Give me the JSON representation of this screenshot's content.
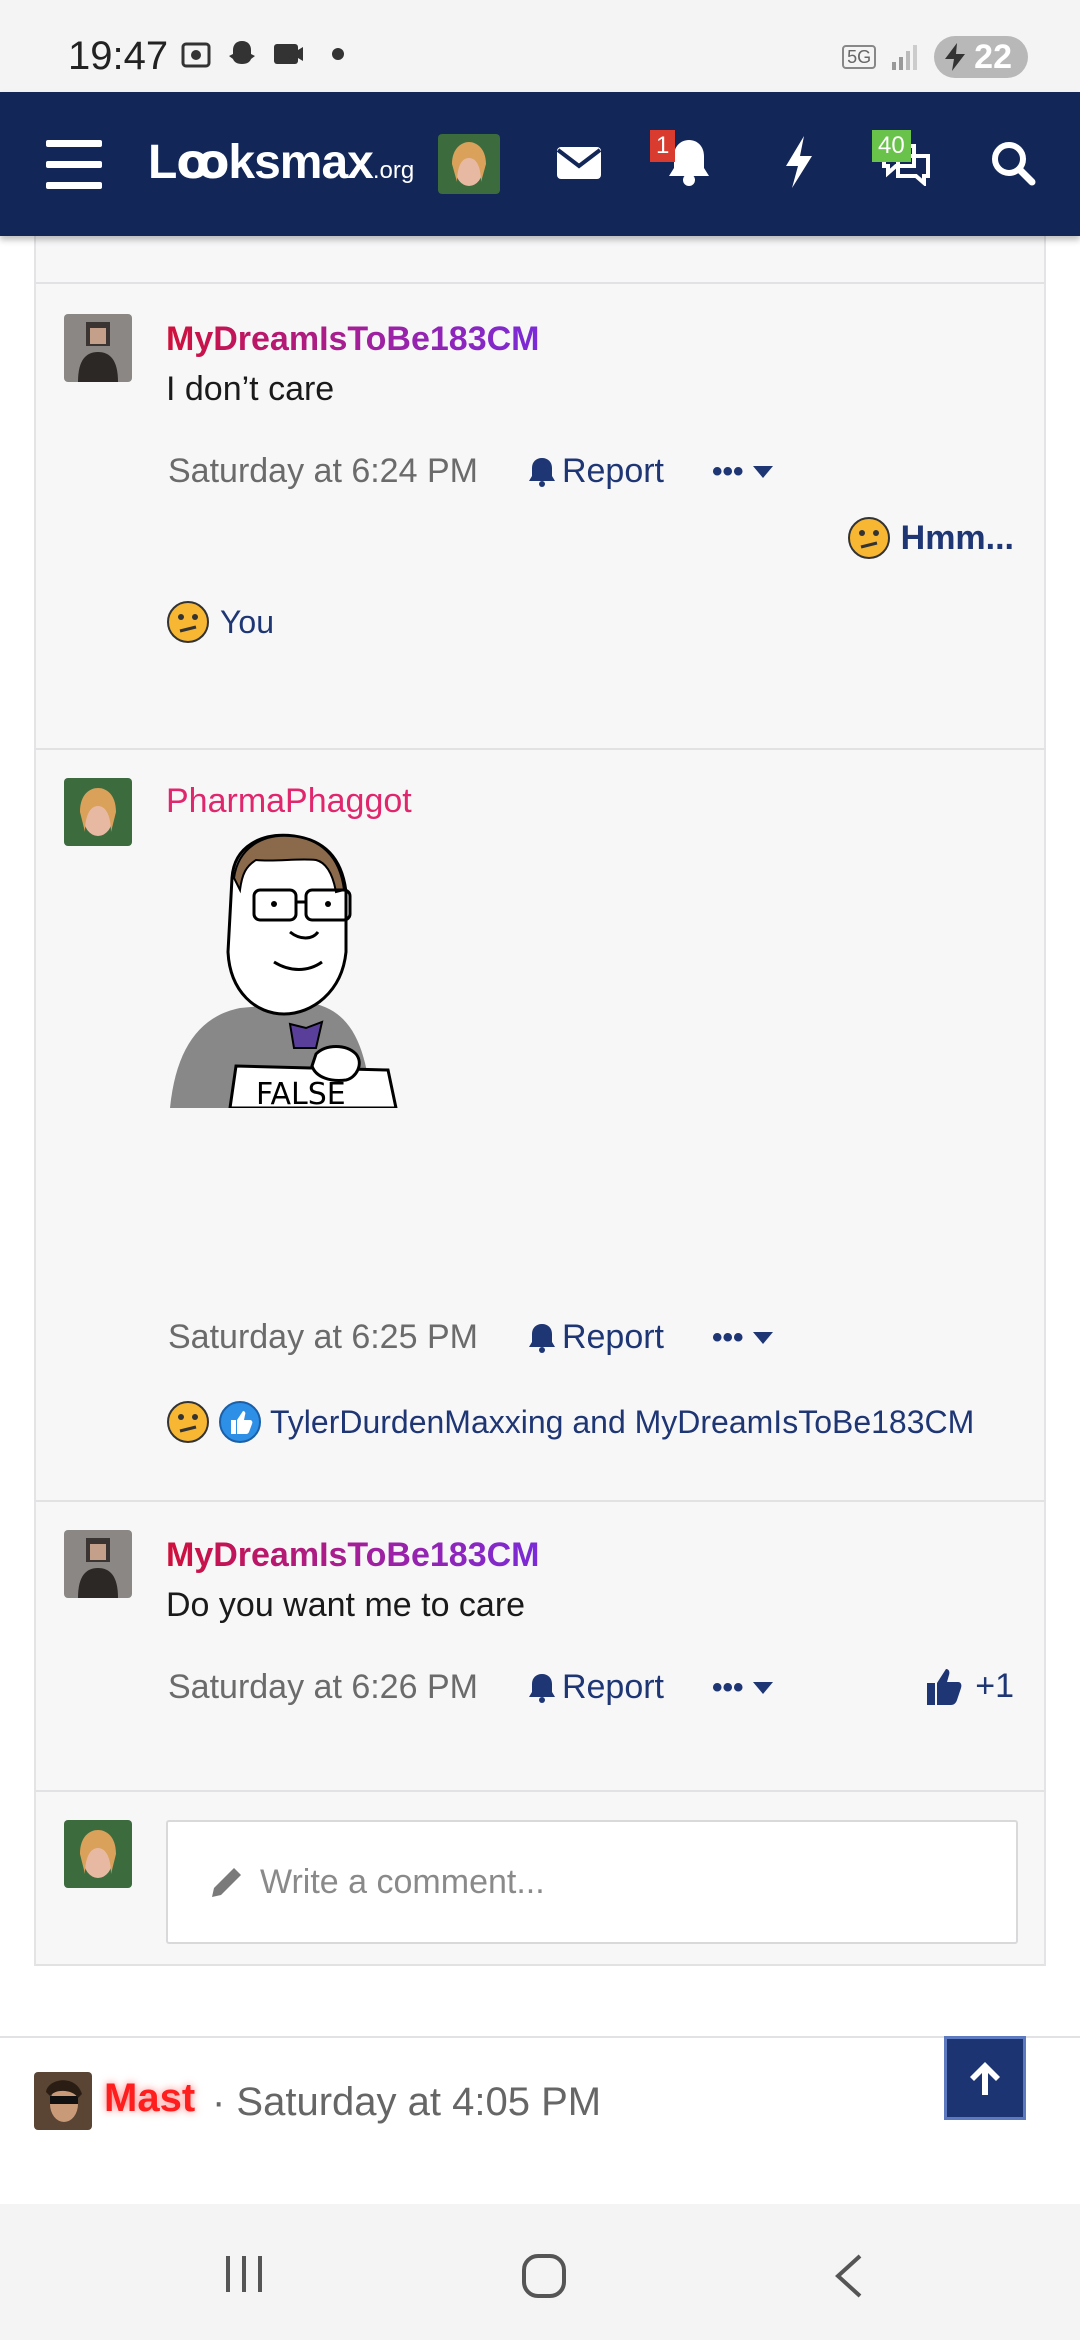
{
  "status_bar": {
    "time": "19:47",
    "network": "5G",
    "battery": "22"
  },
  "nav": {
    "logo_main": "Lꝏksmax",
    "logo_suffix": ".org",
    "notifications_badge": "1",
    "messages_badge": "40"
  },
  "comments": [
    {
      "user": "MyDreamIsToBe183CM",
      "text": "I don’t care",
      "time": "Saturday at 6:24 PM",
      "report": "Report",
      "more": "•••",
      "reaction_summary": "Hmm...",
      "reaction_by": "You"
    },
    {
      "user": "PharmaPhaggot",
      "image_caption": "FALSE",
      "time": "Saturday at 6:25 PM",
      "report": "Report",
      "more": "•••",
      "reaction_by": "TylerDurdenMaxxing and MyDreamIsToBe183CM"
    },
    {
      "user": "MyDreamIsToBe183CM",
      "text": "Do you want me to care",
      "time": "Saturday at 6:26 PM",
      "report": "Report",
      "more": "•••",
      "like_count": "+1"
    }
  ],
  "composer": {
    "placeholder": "Write a comment..."
  },
  "next_post": {
    "user": "Mast",
    "time": "· Saturday at 4:05 PM"
  },
  "colors": {
    "navbar": "#122658",
    "link": "#1f3675",
    "username_pink": "#e0266c",
    "username_mast": "#ff1e1e"
  }
}
